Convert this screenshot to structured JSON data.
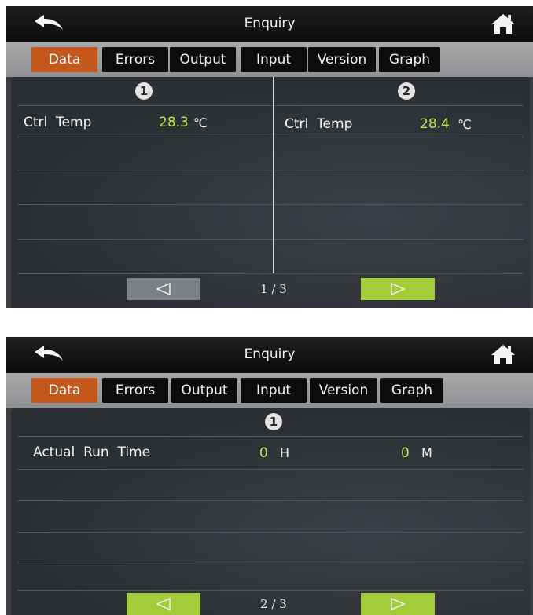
{
  "screens": [
    {
      "title": "Enquiry",
      "tabs": [
        "Data",
        "Errors",
        "Output",
        "Input",
        "Version",
        "Graph"
      ],
      "active_tab": "Data",
      "columns": [
        {
          "badge": "1",
          "label": "Ctrl  Temp",
          "value": "28.3",
          "unit": "℃"
        },
        {
          "badge": "2",
          "label": "Ctrl  Temp",
          "value": "28.4",
          "unit": "℃"
        }
      ],
      "page": "1 / 3"
    },
    {
      "title": "Enquiry",
      "tabs": [
        "Data",
        "Errors",
        "Output",
        "Input",
        "Version",
        "Graph"
      ],
      "active_tab": "Data",
      "badge": "1",
      "label": "Actual  Run  Time",
      "hours_value": "0",
      "hours_unit": "H",
      "minutes_value": "0",
      "minutes_unit": "M",
      "page": "2 / 3"
    }
  ],
  "icons": {
    "back": "back-arrow-icon",
    "home": "home-icon",
    "prev": "triangle-left-icon",
    "next": "triangle-right-icon"
  },
  "colors": {
    "active_tab": "#c4571b",
    "value_green": "#c6e04a",
    "nav_enabled": "#a4cc3a",
    "nav_disabled": "#7d7f86"
  }
}
